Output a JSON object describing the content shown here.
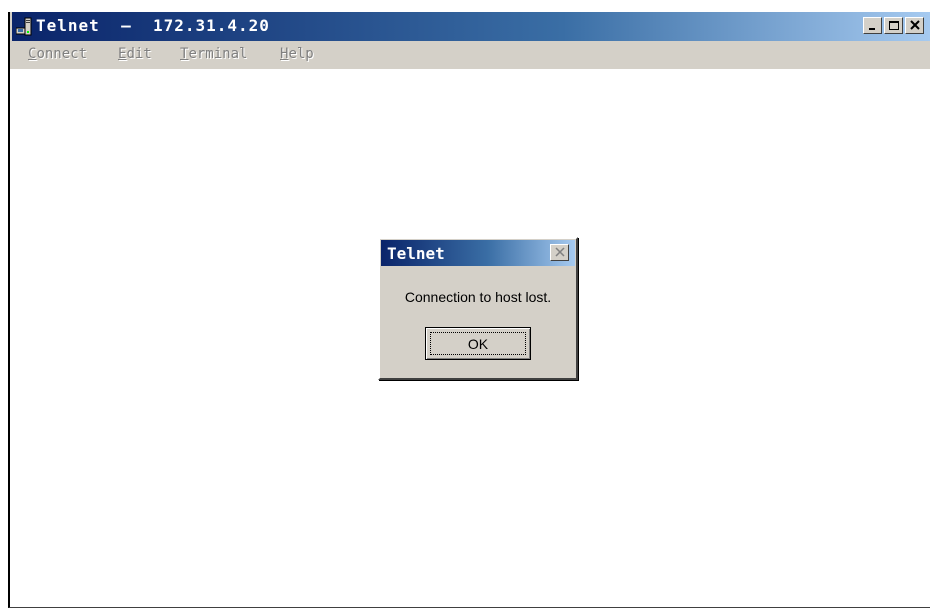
{
  "window": {
    "title": "Telnet  –  172.31.4.20",
    "icon": "telnet-computer-icon",
    "caption_buttons": [
      "minimize-icon",
      "maximize-icon",
      "close-icon"
    ]
  },
  "menubar": {
    "items": [
      {
        "label": "Connect",
        "mnemonic": "C",
        "rest": "onnect"
      },
      {
        "label": "Edit",
        "mnemonic": "E",
        "rest": "dit"
      },
      {
        "label": "Terminal",
        "mnemonic": "T",
        "rest": "erminal"
      },
      {
        "label": "Help",
        "mnemonic": "H",
        "rest": "elp"
      }
    ]
  },
  "dialog": {
    "title": "Telnet",
    "message": "Connection to host lost.",
    "ok_label": "OK"
  },
  "colors": {
    "titlebar_start": "#0a246a",
    "titlebar_end": "#a6caf0",
    "chrome": "#d4d0c8",
    "disabled_text": "#808080"
  }
}
